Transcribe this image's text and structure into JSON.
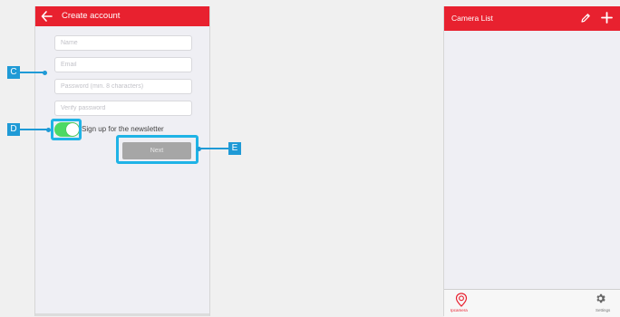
{
  "create_account": {
    "title": "Create account",
    "fields": {
      "name_placeholder": "Name",
      "email_placeholder": "Email",
      "password_placeholder": "Password (min. 8 characters)",
      "verify_placeholder": "Verify password"
    },
    "newsletter": {
      "label": "Sign up for the newsletter",
      "checked": true
    },
    "next_label": "Next"
  },
  "camera_list": {
    "title": "Camera List",
    "tabs": [
      {
        "label": "Ipcamera",
        "icon": "camera-location-icon",
        "active": true
      },
      {
        "label": "Settings",
        "icon": "gear-icon",
        "active": false
      }
    ]
  },
  "annotations": {
    "c": "C",
    "d": "D",
    "e": "E"
  },
  "colors": {
    "header_red": "#e8212f",
    "toggle_green": "#4cd964",
    "callout_blue": "#1f9ad6",
    "button_gray": "#a6a6a6"
  }
}
